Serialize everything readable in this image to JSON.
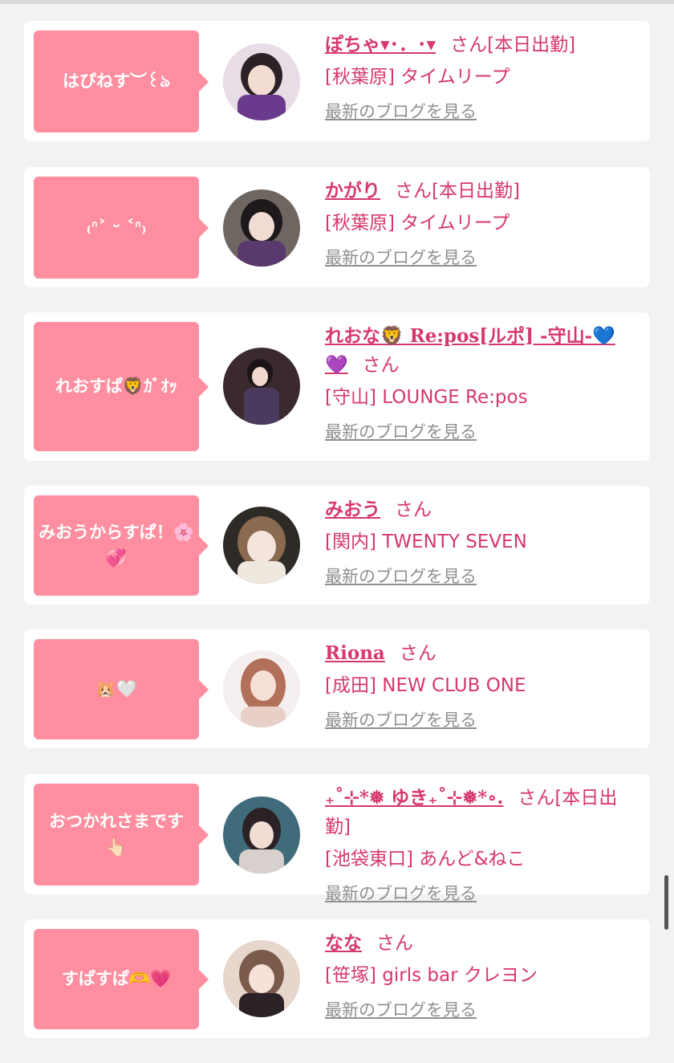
{
  "colors": {
    "bubble": "#ff8fa0",
    "accent": "#d6386b",
    "link_gray": "#8f8f8f",
    "background": "#f2f2f2"
  },
  "entries": [
    {
      "bubble": "はぴねす︶꒰ঌ",
      "name": "ぽちゃ▾･．･▾",
      "san": "さん",
      "badge": "[本日出勤]",
      "shop": "[秋葉原] タイムリープ",
      "blog": "最新のブログを見る",
      "avatar_color": "#6a3b8c"
    },
    {
      "bubble": "₍ᐢ˃ ᵕ ˂ᐢ₎",
      "name": "かがり",
      "san": "さん",
      "badge": "[本日出勤]",
      "shop": "[秋葉原] タイムリープ",
      "blog": "最新のブログを見る",
      "avatar_color": "#5a3a6e"
    },
    {
      "bubble": "れおすぱ🦁ｶﾞｵｯ",
      "name": "れおな🦁 Re:pos[ルポ] -守山-💙💜",
      "san": "さん",
      "badge": "",
      "shop": "[守山] LOUNGE Re:pos",
      "blog": "最新のブログを見る",
      "avatar_color": "#4a3040"
    },
    {
      "bubble": "みおうからすぱ！🌸💞",
      "name": "みおう",
      "san": "さん",
      "badge": "",
      "shop": "[関内] TWENTY SEVEN",
      "blog": "最新のブログを見る",
      "avatar_color": "#8a6a50"
    },
    {
      "bubble": "🐹🤍",
      "name": "Riona",
      "san": "さん",
      "badge": "",
      "shop": "[成田] NEW CLUB ONE",
      "blog": "最新のブログを見る",
      "avatar_color": "#c7897a"
    },
    {
      "bubble": "おつかれさまです 👆🏻",
      "name": "₊˚⊹*❅ ゆき₊˚⊹❅*∘.",
      "san": "さん",
      "badge": "[本日出勤]",
      "shop": "[池袋東口] あんど&ねこ",
      "blog": "最新のブログを見る",
      "avatar_color": "#3f6b7a"
    },
    {
      "bubble": "すぱすぱ🫶💗",
      "name": "なな",
      "san": "さん",
      "badge": "",
      "shop": "[笹塚] girls bar クレヨン",
      "blog": "最新のブログを見る",
      "avatar_color": "#7a5a4a"
    }
  ]
}
